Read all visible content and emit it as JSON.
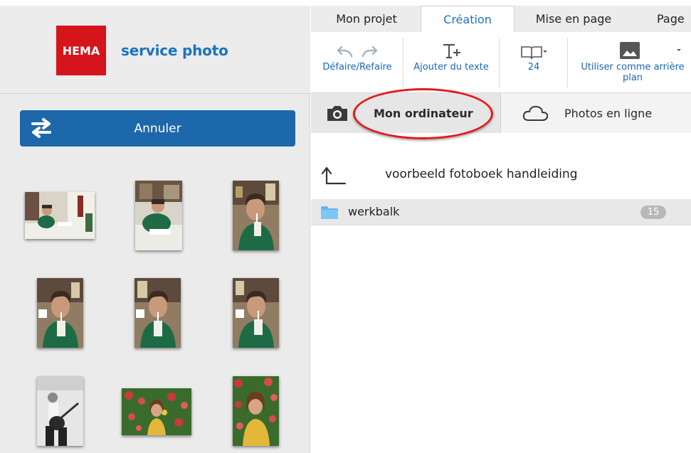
{
  "app": {
    "brand_logo": "HEMA",
    "brand_name": "service photo"
  },
  "tabs": [
    {
      "label": "Mon projet"
    },
    {
      "label": "Création",
      "active": true
    },
    {
      "label": "Mise en page"
    },
    {
      "label": "Page"
    }
  ],
  "toolbar": {
    "undo_redo_label": "Défaire/Refaire",
    "add_text_label": "Ajouter du texte",
    "pages_label": "24",
    "background_label": "Utiliser comme arrière plan"
  },
  "left_panel": {
    "cancel_label": "Annuler",
    "photos": [
      {
        "icon": "photo-man-table"
      },
      {
        "icon": "photo-man-reading"
      },
      {
        "icon": "photo-man-drinking"
      },
      {
        "icon": "photo-man-drinking"
      },
      {
        "icon": "photo-man-drinking"
      },
      {
        "icon": "photo-man-drinking"
      },
      {
        "icon": "photo-guitar-bw"
      },
      {
        "icon": "photo-woman-flowers"
      },
      {
        "icon": "photo-woman-flowers"
      }
    ]
  },
  "sources": {
    "computer_label": "Mon ordinateur",
    "online_label": "Photos en ligne",
    "active": "Mon ordinateur"
  },
  "browser": {
    "current_folder": "voorbeeld fotoboek handleiding",
    "folders": [
      {
        "name": "werkbalk",
        "count": "15"
      }
    ]
  },
  "colors": {
    "accent": "#1a73c1",
    "brand_red": "#d6141b",
    "button_blue": "#1d68aa",
    "highlight_oval": "#e21b1b"
  }
}
